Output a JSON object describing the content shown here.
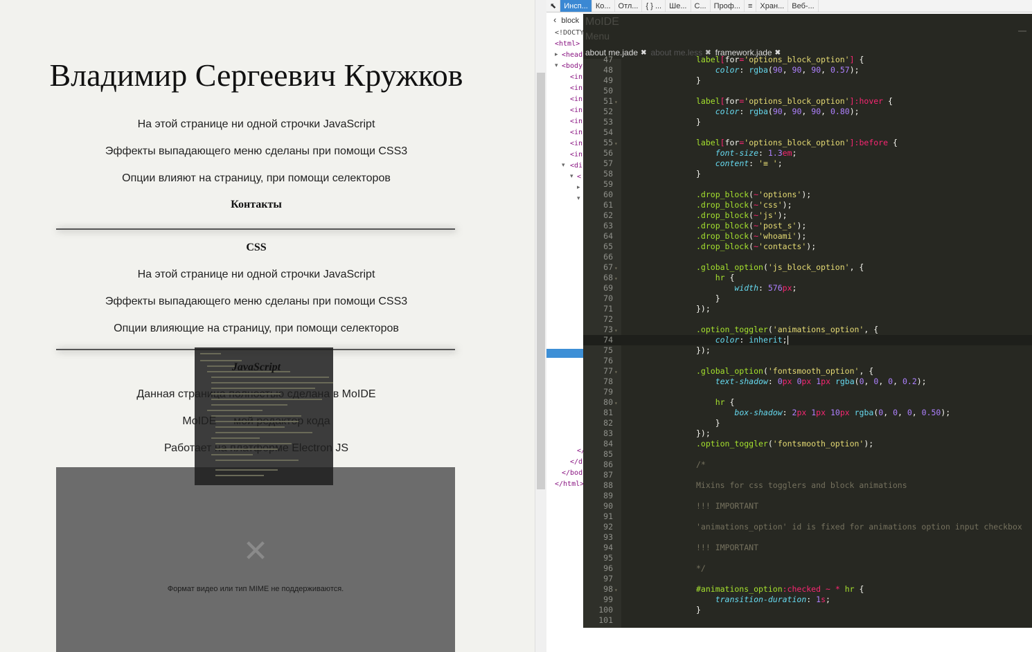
{
  "page": {
    "title": "Владимир Сергеевич Кружков",
    "intro_lines": [
      "На этой странице ни одной строчки JavaScript",
      "Эффекты выпадающего меню сделаны при помощи CSS3",
      "Опции влияют на страницу, при помощи селекторов"
    ],
    "contacts_heading": "Контакты",
    "css_heading": "CSS",
    "css_lines": [
      "На этой странице ни одной строчки JavaScript",
      "Эффекты выпадающего меню сделаны при помощи CSS3",
      "Опции влияющие на страницу, при помощи селекторов"
    ],
    "js_heading": "JavaScript",
    "js_lines": [
      "Данная страница полностью сделана в MoIDE",
      "MoIDE — мой редактор кода",
      "Работает на платформе Electron JS"
    ],
    "video_error": "Формат видео или тип MIME не поддерживаются."
  },
  "devtools": {
    "toolbar": [
      "Инсп...",
      "Ко...",
      "Отл...",
      "{ } ...",
      "Ше...",
      "С...",
      "Проф...",
      "",
      "Хран...",
      "Веб-..."
    ],
    "breadcrumb": "block",
    "dom_lines": [
      "<!DOCTY",
      "<html>",
      "<head",
      "<body",
      "<in",
      "<in",
      "<in",
      "<in",
      "<in",
      "<in",
      "<in",
      "<in",
      "<di",
      "<",
      "</",
      "</d",
      "</bod",
      "</html>"
    ]
  },
  "editor": {
    "app_name": "MoIDE",
    "menu_label": "Menu",
    "tabs": [
      {
        "name": "about me.jade",
        "active": true
      },
      {
        "name": "about me.less",
        "active": false
      },
      {
        "name": "framework.jade",
        "active": true
      }
    ],
    "first_line": 47,
    "cursor_line": 74,
    "lines": [
      "label[for='options_block_option'] {",
      "    color: rgba(90, 90, 90, 0.57);",
      "}",
      "",
      "label[for='options_block_option']:hover {",
      "    color: rgba(90, 90, 90, 0.80);",
      "}",
      "",
      "label[for='options_block_option']:before {",
      "    font-size: 1.3em;",
      "    content: '≡ ';",
      "}",
      "",
      ".drop_block(~'options');",
      ".drop_block(~'css');",
      ".drop_block(~'js');",
      ".drop_block(~'post_s');",
      ".drop_block(~'whoami');",
      ".drop_block(~'contacts');",
      "",
      ".global_option('js_block_option', {",
      "    hr {",
      "        width: 576px;",
      "    }",
      "});",
      "",
      ".option_toggler('animations_option', {",
      "    color: inherit;",
      "});",
      "",
      ".global_option('fontsmooth_option', {",
      "    text-shadow: 0px 0px 1px rgba(0, 0, 0, 0.2);",
      "",
      "    hr {",
      "        box-shadow: 2px 1px 10px rgba(0, 0, 0, 0.50);",
      "    }",
      "});",
      ".option_toggler('fontsmooth_option');",
      "",
      "/*",
      "",
      "Mixins for css togglers and block animations",
      "",
      "!!! IMPORTANT",
      "",
      "'animations_option' id is fixed for animations option input checkbox",
      "",
      "!!! IMPORTANT",
      "",
      "*/",
      "",
      "#animations_option:checked ~ * hr {",
      "    transition-duration: 1s;",
      "}",
      ""
    ]
  }
}
